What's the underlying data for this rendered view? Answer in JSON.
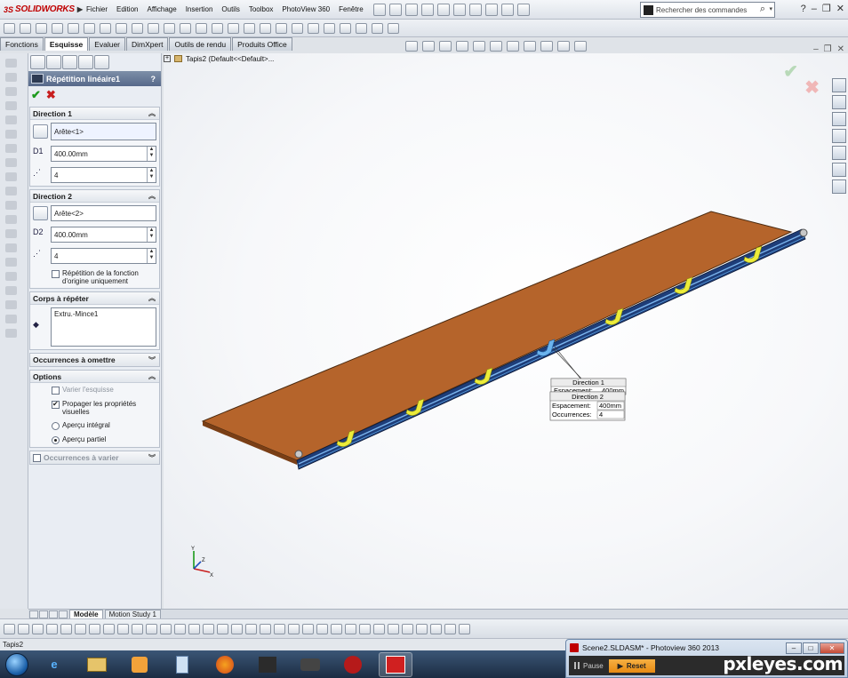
{
  "app": {
    "logo_ds": "3S",
    "logo_text": "SOLIDWORKS",
    "menu": [
      "Fichier",
      "Edition",
      "Affichage",
      "Insertion",
      "Outils",
      "Toolbox",
      "PhotoView 360",
      "Fenêtre"
    ],
    "search_placeholder": "Rechercher des commandes"
  },
  "command_tabs": [
    "Fonctions",
    "Esquisse",
    "Evaluer",
    "DimXpert",
    "Outils de rendu",
    "Produits Office"
  ],
  "active_tab": "Esquisse",
  "property_manager": {
    "title": "Répétition linéaire1",
    "help": "?",
    "direction1": {
      "label": "Direction 1",
      "edge": "Arête<1>",
      "spacing": "400.00mm",
      "count": "4",
      "spacing_icon": "D1"
    },
    "direction2": {
      "label": "Direction 2",
      "edge": "Arête<2>",
      "spacing": "400.00mm",
      "count": "4",
      "spacing_icon": "D2",
      "seed_only_label": "Répétition de la fonction d'origine uniquement"
    },
    "bodies": {
      "label": "Corps à répéter",
      "item": "Extru.-Mince1"
    },
    "skip_label": "Occurrences à omettre",
    "options": {
      "label": "Options",
      "vary_sketch": "Varier l'esquisse",
      "propagate": "Propager les propriétés visuelles",
      "full_preview": "Aperçu intégral",
      "partial_preview": "Aperçu partiel"
    },
    "vary_label": "Occurrences à varier"
  },
  "viewport": {
    "tree_label": "Tapis2  (Default<<Default>...",
    "callout": {
      "dir1_title": "Direction 1",
      "dir1_spacing_label": "Espacement:",
      "dir1_spacing": "400mm",
      "dir2_title": "Direction 2",
      "dir2_spacing_label": "Espacement:",
      "dir2_spacing": "400mm",
      "occ_label": "Occurrences:",
      "occ_value": "4"
    },
    "triad": {
      "x": "X",
      "y": "Y",
      "z": "Z"
    }
  },
  "bottom_tabs": [
    "Modèle",
    "Motion Study 1"
  ],
  "status_text": "Tapis2",
  "photoview": {
    "title": "Scene2.SLDASM* - Photoview 360 2013",
    "pause": "Pause",
    "reset": "Reset"
  },
  "watermark": "pxleyes.com",
  "colors": {
    "accent": "#57698a",
    "plate": "#b3622a",
    "rail": "#1f3f7a",
    "bracket": "#e8e83a"
  }
}
